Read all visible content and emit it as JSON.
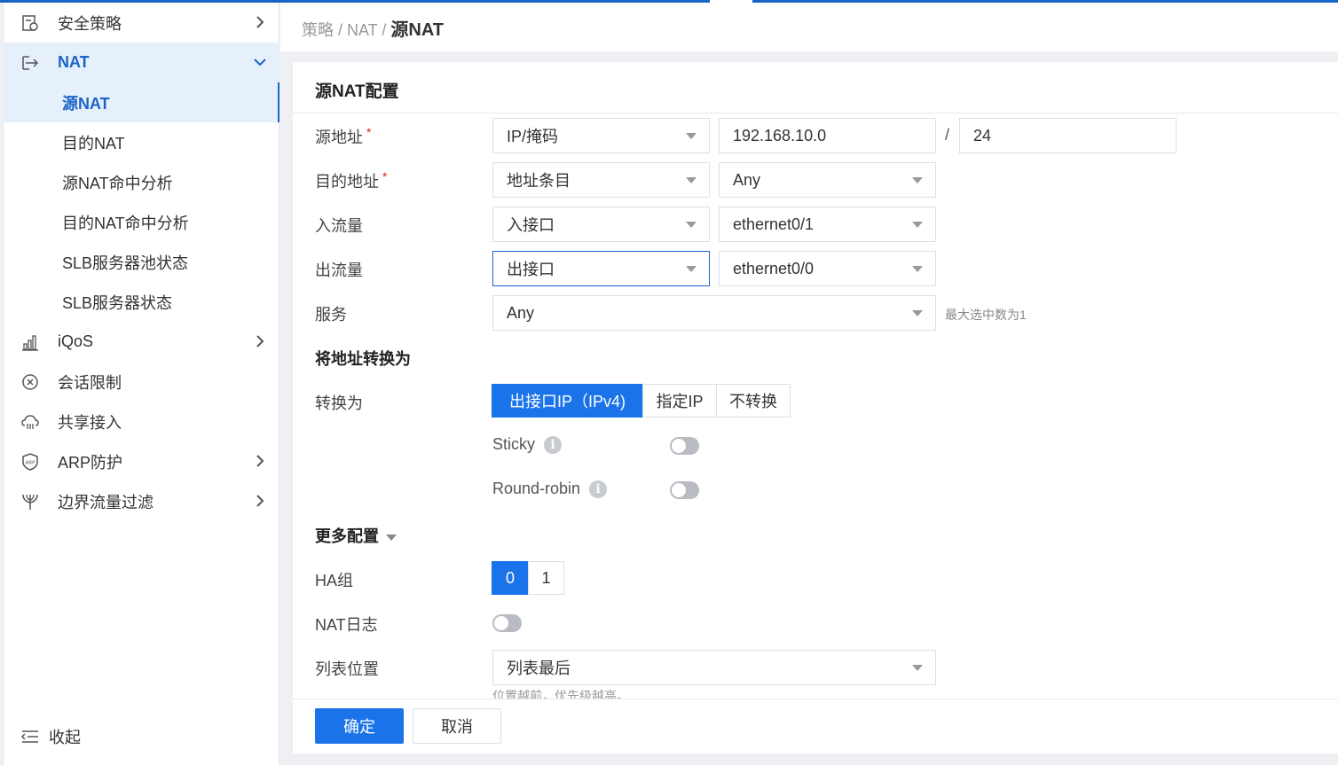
{
  "breadcrumb": {
    "part1": "策略",
    "sep1": " / ",
    "part2": "NAT",
    "sep2": " / ",
    "current": "源NAT"
  },
  "sidebar": {
    "items": [
      {
        "label": "安全策略",
        "icon": "security-policy-icon"
      },
      {
        "label": "NAT",
        "icon": "nat-icon"
      },
      {
        "label": "源NAT"
      },
      {
        "label": "目的NAT"
      },
      {
        "label": "源NAT命中分析"
      },
      {
        "label": "目的NAT命中分析"
      },
      {
        "label": "SLB服务器池状态"
      },
      {
        "label": "SLB服务器状态"
      },
      {
        "label": "iQoS",
        "icon": "bar-chart-icon"
      },
      {
        "label": "会话限制",
        "icon": "session-limit-icon"
      },
      {
        "label": "共享接入",
        "icon": "cloud-share-icon"
      },
      {
        "label": "ARP防护",
        "icon": "arp-shield-icon"
      },
      {
        "label": "边界流量过滤",
        "icon": "filter-icon"
      }
    ],
    "collapse_label": "收起"
  },
  "form": {
    "title": "源NAT配置",
    "src_addr": {
      "label": "源地址",
      "required": "*",
      "type": "IP/掩码",
      "ip": "192.168.10.0",
      "slash": "/",
      "mask": "24"
    },
    "dst_addr": {
      "label": "目的地址",
      "required": "*",
      "type": "地址条目",
      "value": "Any"
    },
    "ingress": {
      "label": "入流量",
      "type": "入接口",
      "value": "ethernet0/1"
    },
    "egress": {
      "label": "出流量",
      "type": "出接口",
      "value": "ethernet0/0"
    },
    "service": {
      "label": "服务",
      "value": "Any",
      "hint": "最大选中数为1"
    },
    "translate_section": "将地址转换为",
    "translate": {
      "label": "转换为",
      "options": [
        "出接口IP（IPv4)",
        "指定IP",
        "不转换"
      ],
      "selected": "出接口IP（IPv4)"
    },
    "sticky": {
      "label": "Sticky",
      "info": "i",
      "on": false
    },
    "round_robin": {
      "label": "Round-robin",
      "info": "i",
      "on": false
    },
    "more_section": "更多配置",
    "ha_group": {
      "label": "HA组",
      "options": [
        "0",
        "1"
      ],
      "selected": "0"
    },
    "nat_log": {
      "label": "NAT日志",
      "on": false
    },
    "list_pos": {
      "label": "列表位置",
      "value": "列表最后",
      "hint": "位置越前，优先级越高。"
    }
  },
  "buttons": {
    "ok": "确定",
    "cancel": "取消"
  },
  "colors": {
    "accent": "#1a73e8",
    "active_bg": "#e6f0fb",
    "required": "#e02020"
  }
}
